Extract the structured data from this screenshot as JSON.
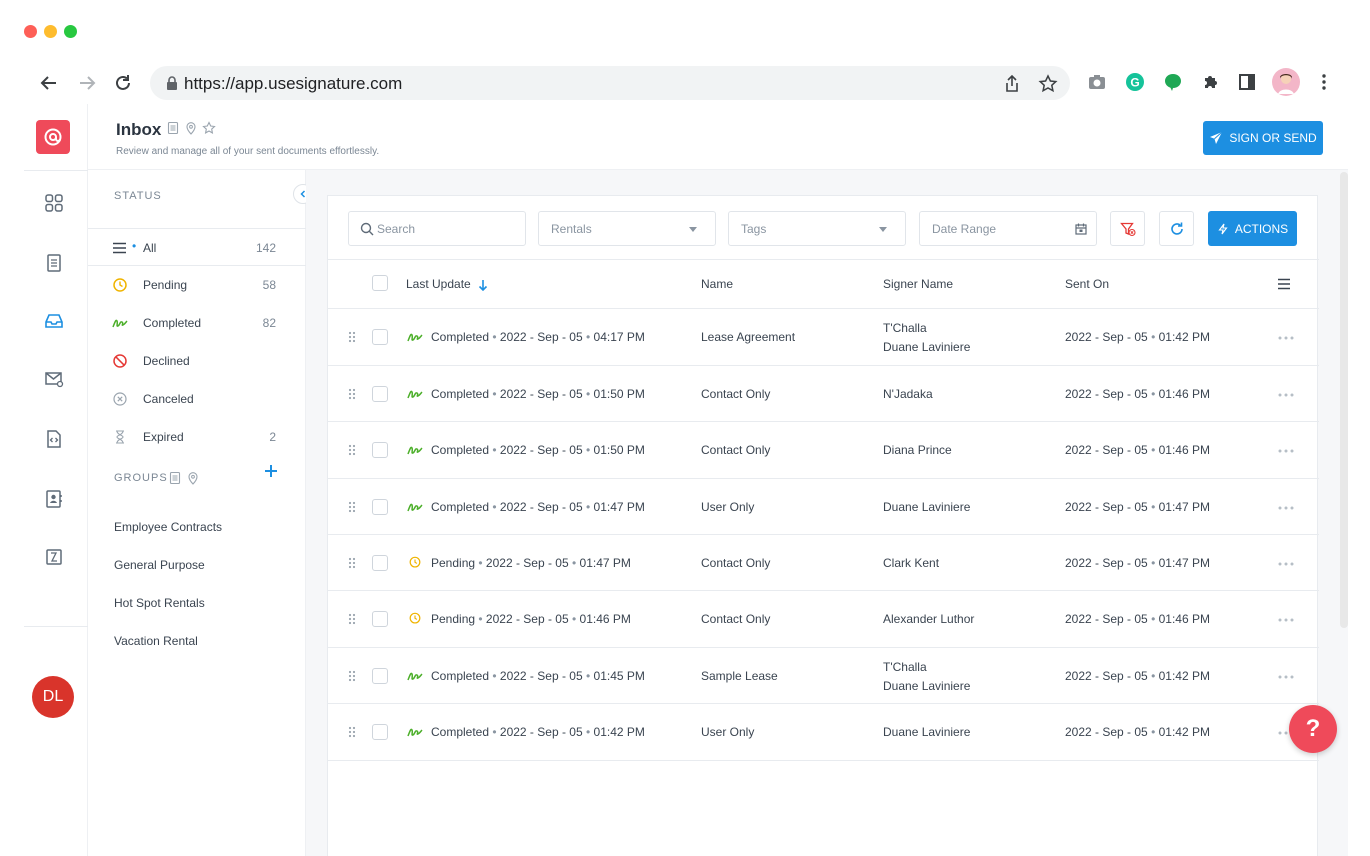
{
  "browser": {
    "url": "https://app.usesignature.com"
  },
  "header": {
    "title": "Inbox",
    "subtitle": "Review and manage all of your sent documents effortlessly.",
    "sign_button": "SIGN OR SEND"
  },
  "user": {
    "initials": "DL"
  },
  "sidebar": {
    "status_heading": "STATUS",
    "statuses": [
      {
        "label": "All",
        "count": "142",
        "icon": "menu-icon"
      },
      {
        "label": "Pending",
        "count": "58",
        "icon": "clock-icon"
      },
      {
        "label": "Completed",
        "count": "82",
        "icon": "signature-icon"
      },
      {
        "label": "Declined",
        "count": "",
        "icon": "ban-icon"
      },
      {
        "label": "Canceled",
        "count": "",
        "icon": "x-circle-icon"
      },
      {
        "label": "Expired",
        "count": "2",
        "icon": "hourglass-icon"
      }
    ],
    "groups_heading": "GROUPS",
    "groups": [
      "Employee Contracts",
      "General Purpose",
      "Hot Spot Rentals",
      "Vacation Rental"
    ]
  },
  "filters": {
    "search_placeholder": "Search",
    "group_value": "Rentals",
    "tags_placeholder": "Tags",
    "date_placeholder": "Date Range",
    "actions_label": "ACTIONS"
  },
  "table": {
    "columns": {
      "last_update": "Last Update",
      "name": "Name",
      "signer": "Signer Name",
      "sent_on": "Sent On"
    },
    "rows": [
      {
        "status": "Completed",
        "updated": "2022 - Sep - 05",
        "updated_time": "04:17 PM",
        "name": "Lease Agreement",
        "signer1": "T'Challa",
        "signer2": "Duane Laviniere",
        "sent": "2022 - Sep - 05",
        "sent_time": "01:42 PM"
      },
      {
        "status": "Completed",
        "updated": "2022 - Sep - 05",
        "updated_time": "01:50 PM",
        "name": "Contact Only",
        "signer1": "N'Jadaka",
        "signer2": "",
        "sent": "2022 - Sep - 05",
        "sent_time": "01:46 PM"
      },
      {
        "status": "Completed",
        "updated": "2022 - Sep - 05",
        "updated_time": "01:50 PM",
        "name": "Contact Only",
        "signer1": "Diana Prince",
        "signer2": "",
        "sent": "2022 - Sep - 05",
        "sent_time": "01:46 PM"
      },
      {
        "status": "Completed",
        "updated": "2022 - Sep - 05",
        "updated_time": "01:47 PM",
        "name": "User Only",
        "signer1": "Duane Laviniere",
        "signer2": "",
        "sent": "2022 - Sep - 05",
        "sent_time": "01:47 PM"
      },
      {
        "status": "Pending",
        "updated": "2022 - Sep - 05",
        "updated_time": "01:47 PM",
        "name": "Contact Only",
        "signer1": "Clark Kent",
        "signer2": "",
        "sent": "2022 - Sep - 05",
        "sent_time": "01:47 PM"
      },
      {
        "status": "Pending",
        "updated": "2022 - Sep - 05",
        "updated_time": "01:46 PM",
        "name": "Contact Only",
        "signer1": "Alexander Luthor",
        "signer2": "",
        "sent": "2022 - Sep - 05",
        "sent_time": "01:46 PM"
      },
      {
        "status": "Completed",
        "updated": "2022 - Sep - 05",
        "updated_time": "01:45 PM",
        "name": "Sample Lease",
        "signer1": "T'Challa",
        "signer2": "Duane Laviniere",
        "sent": "2022 - Sep - 05",
        "sent_time": "01:42 PM"
      },
      {
        "status": "Completed",
        "updated": "2022 - Sep - 05",
        "updated_time": "01:42 PM",
        "name": "User Only",
        "signer1": "Duane Laviniere",
        "signer2": "",
        "sent": "2022 - Sep - 05",
        "sent_time": "01:42 PM"
      }
    ]
  },
  "help": {
    "label": "?"
  },
  "colors": {
    "accent": "#1d8fe1",
    "brand": "#ef4a5a",
    "completed": "#4caf2a",
    "pending": "#f0b400",
    "declined": "#e53935"
  }
}
